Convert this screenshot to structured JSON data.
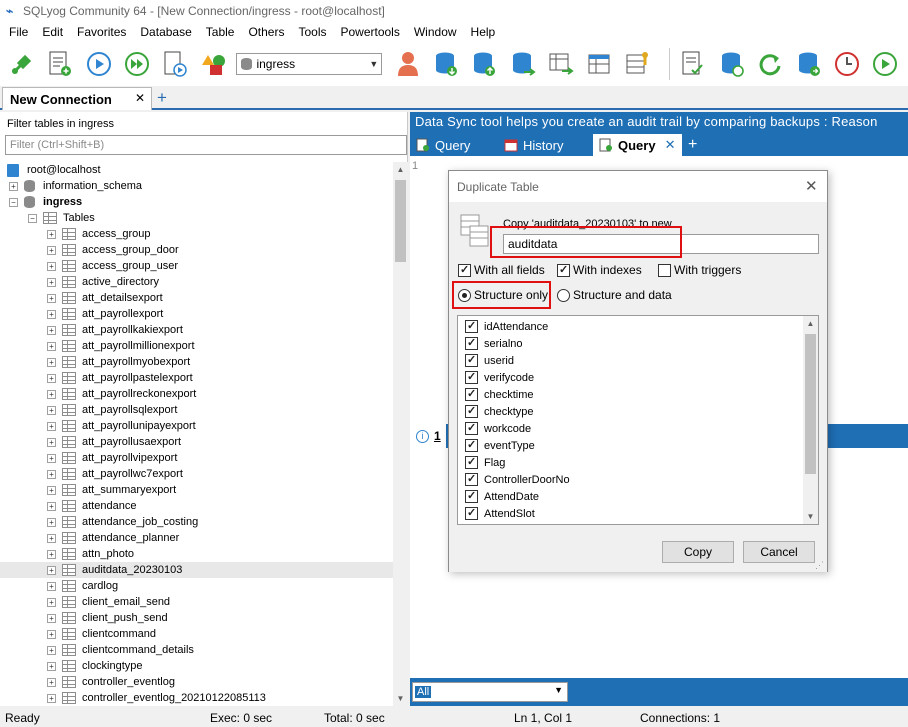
{
  "window": {
    "title": "SQLyog Community 64 - [New Connection/ingress - root@localhost]"
  },
  "menu": [
    "File",
    "Edit",
    "Favorites",
    "Database",
    "Table",
    "Others",
    "Tools",
    "Powertools",
    "Window",
    "Help"
  ],
  "toolbar": {
    "database_selector": "ingress",
    "icons": [
      "new-connection-icon",
      "new-query-icon",
      "execute-query-icon",
      "execute-all-icon",
      "execute-edit-icon",
      "schema-designer-icon",
      "backup-icon",
      "restore-icon",
      "data-sync-icon",
      "import-icon",
      "query-builder-icon",
      "table-diagnostics-icon",
      "user-manager-icon",
      "refresh-icon",
      "copy-database-icon",
      "scheduled-task-icon",
      "notifications-icon"
    ]
  },
  "connection_tabs": [
    {
      "label": "New Connection",
      "active": true
    }
  ],
  "object_browser": {
    "filter_label": "Filter tables in ingress",
    "filter_placeholder": "Filter (Ctrl+Shift+B)",
    "server": "root@localhost",
    "databases": [
      "information_schema",
      "ingress"
    ],
    "tables_folder": "Tables",
    "tables": [
      "access_group",
      "access_group_door",
      "access_group_user",
      "active_directory",
      "att_detailsexport",
      "att_payrollexport",
      "att_payrollkakiexport",
      "att_payrollmillionexport",
      "att_payrollmyobexport",
      "att_payrollpastelexport",
      "att_payrollreckonexport",
      "att_payrollsqlexport",
      "att_payrollunipayexport",
      "att_payrollusaexport",
      "att_payrollvipexport",
      "att_payrollwc7export",
      "att_summaryexport",
      "attendance",
      "attendance_job_costing",
      "attendance_planner",
      "attn_photo",
      "auditdata_20230103",
      "cardlog",
      "client_email_send",
      "client_push_send",
      "clientcommand",
      "clientcommand_details",
      "clockingtype",
      "controller_eventlog",
      "controller_eventlog_20210122085113"
    ],
    "selected_table": "auditdata_20230103"
  },
  "query_area": {
    "banner": "Data Sync tool helps you create an audit trail by comparing backups : Reason",
    "tabs": [
      {
        "label": "Query",
        "icon": "query-tab-icon",
        "active": false
      },
      {
        "label": "History",
        "icon": "history-calendar-icon",
        "active": false
      },
      {
        "label": "Query",
        "icon": "query-tab-icon",
        "active": true
      }
    ],
    "editor_line": "1",
    "result_tab": "1",
    "filter_value": "All"
  },
  "dialog": {
    "title": "Duplicate Table",
    "copy_label": "Copy 'auditdata_20230103' to new",
    "new_table_name": "auditdata",
    "options": [
      {
        "label": "With all fields",
        "checked": true
      },
      {
        "label": "With indexes",
        "checked": true
      },
      {
        "label": "With triggers",
        "checked": false
      }
    ],
    "structure_options": [
      {
        "label": "Structure only",
        "selected": true
      },
      {
        "label": "Structure and data",
        "selected": false
      }
    ],
    "fields": [
      "idAttendance",
      "serialno",
      "userid",
      "verifycode",
      "checktime",
      "checktype",
      "workcode",
      "eventType",
      "Flag",
      "ControllerDoorNo",
      "AttendDate",
      "AttendSlot"
    ],
    "copy_button": "Copy",
    "cancel_button": "Cancel"
  },
  "status_bar": {
    "state": "Ready",
    "exec": "Exec: 0 sec",
    "total": "Total: 0 sec",
    "position": "Ln 1, Col 1",
    "connections": "Connections: 1"
  },
  "colors": {
    "accent": "#1f6fb5",
    "highlight": "#e01010"
  }
}
